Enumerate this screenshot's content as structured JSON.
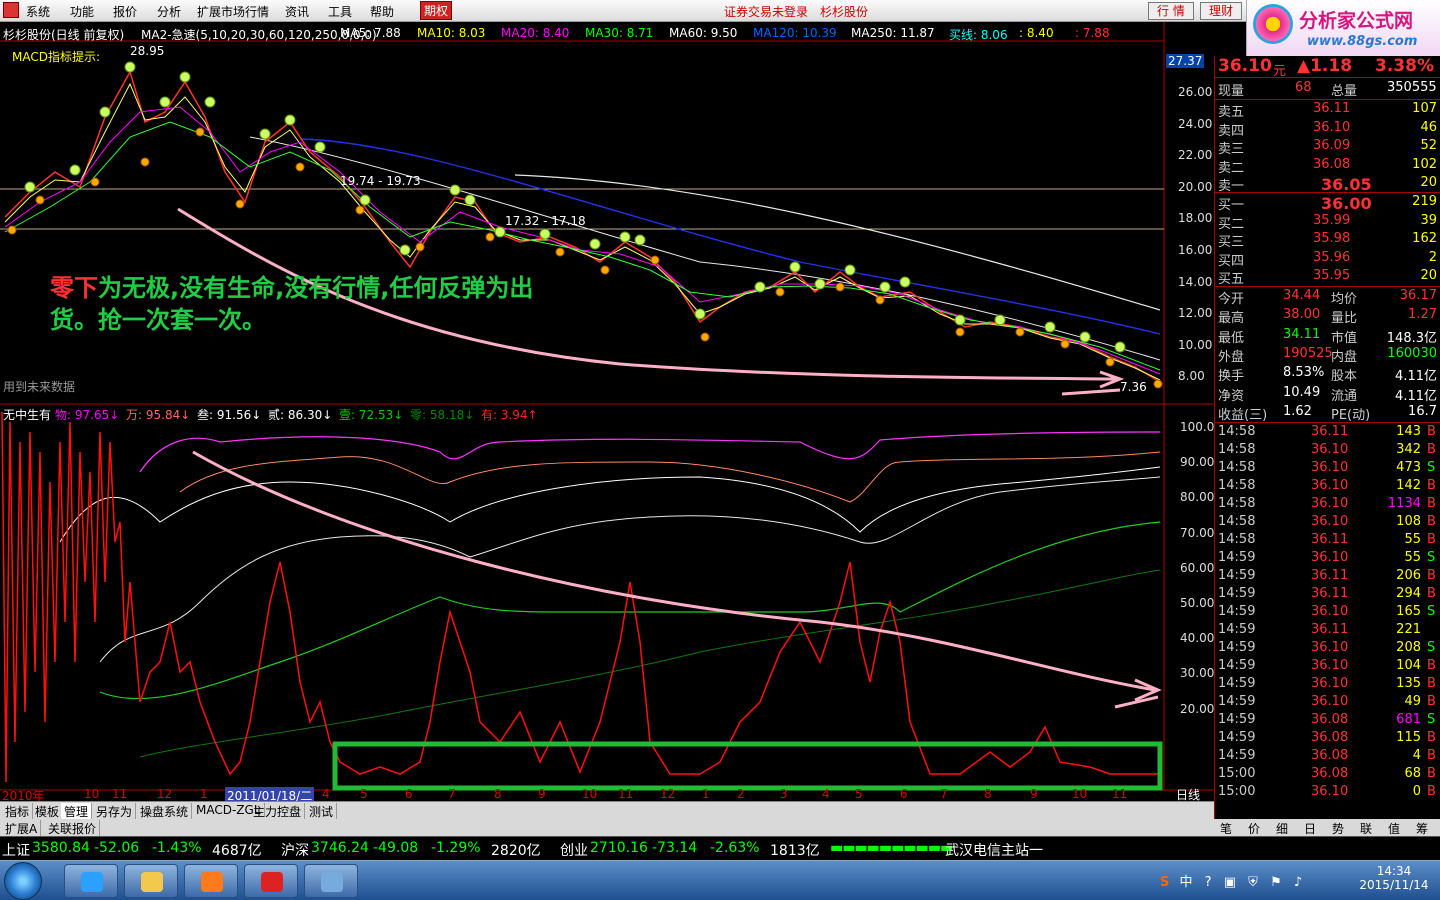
{
  "menubar": {
    "items": [
      "系统",
      "功能",
      "报价",
      "分析",
      "扩展市场行情",
      "资讯",
      "工具",
      "帮助"
    ],
    "active_button": "期权",
    "status": "证券交易未登录",
    "stock_name": "杉杉股份",
    "tabs": [
      "行 情",
      "理财"
    ]
  },
  "logo": {
    "title": "分析家公式网",
    "url_text": "www.88gs.com"
  },
  "main_panel": {
    "title": "杉杉股份(日线 前复权)",
    "formula": "MA2-急速(5,10,20,30,60,120,250,0,0,0)",
    "ma": [
      {
        "label": "MA5: 7.88",
        "color": "#ffffff"
      },
      {
        "label": "MA10: 8.03",
        "color": "#ffff00"
      },
      {
        "label": "MA20: 8.40",
        "color": "#ff00ff"
      },
      {
        "label": "MA30: 8.71",
        "color": "#00ff00"
      },
      {
        "label": "MA60: 9.50",
        "color": "#ffffff"
      },
      {
        "label": "MA120: 10.39",
        "color": "#0066ff"
      },
      {
        "label": "MA250: 11.87",
        "color": "#ffffff"
      },
      {
        "label": "买线: 8.06",
        "color": "#00ffff"
      },
      {
        "label": ": 8.40",
        "color": "#ffff00"
      },
      {
        "label": ": 7.88",
        "color": "#ff3333"
      }
    ],
    "macd_hint": "MACD指标提示:",
    "price_labels": [
      "28.95",
      "19.74 - 19.73",
      "17.32 - 17.18",
      "7.36"
    ],
    "current_price_tag": "27.37",
    "y_ticks": [
      "26.00",
      "24.00",
      "22.00",
      "20.00",
      "18.00",
      "16.00",
      "14.00",
      "12.00",
      "10.00",
      "8.00"
    ],
    "annotation_red": "零下",
    "annotation_green": "为无极,没有生命,没有行情,任何反弹为出",
    "annotation_red2": "货。抢一次套一次。",
    "footnote": "用到未来数据"
  },
  "sub_panel": {
    "title": "无中生有",
    "lines": [
      {
        "label": "物: 97.65",
        "color": "#ff00ff",
        "arrow": "↓"
      },
      {
        "label": "万: 95.84",
        "color": "#ff6666",
        "arrow": "↓"
      },
      {
        "label": "叁: 91.56",
        "color": "#ffffff",
        "arrow": "↓"
      },
      {
        "label": "贰: 86.30",
        "color": "#ffffff",
        "arrow": "↓"
      },
      {
        "label": "壹: 72.53",
        "color": "#00cc00",
        "arrow": "↓"
      },
      {
        "label": "零: 58.18",
        "color": "#008800",
        "arrow": "↓"
      },
      {
        "label": "有: 3.94",
        "color": "#ff2222",
        "arrow": "↑"
      }
    ],
    "y_ticks": [
      "100.0",
      "90.00",
      "80.00",
      "70.00",
      "60.00",
      "50.00",
      "40.00",
      "30.00",
      "20.00"
    ]
  },
  "x_axis": {
    "labels": [
      "2010年",
      "10",
      "11",
      "12",
      "1",
      "2011/01/18/二",
      "4",
      "5",
      "6",
      "7",
      "8",
      "9",
      "10",
      "11",
      "12",
      "1",
      "2",
      "3",
      "4",
      "5",
      "6",
      "7",
      "8",
      "9",
      "10",
      "11"
    ],
    "period": "日线"
  },
  "bottom_tabs": [
    "指标",
    "模板",
    "管理",
    "另存为",
    "操盘系统",
    "MACD-ZGL",
    "主力控盘",
    "测试"
  ],
  "bottom_tabs2": [
    "扩展A",
    "关联报价"
  ],
  "quote": {
    "price": "36.10",
    "unit": "元",
    "change": "▲1.18",
    "change_pct": "3.38%",
    "volume_now_label": "现量",
    "volume_now": "68",
    "volume_total_label": "总量",
    "volume_total": "350555",
    "asks": [
      {
        "label": "卖五",
        "price": "36.11",
        "vol": "107"
      },
      {
        "label": "卖四",
        "price": "36.10",
        "vol": "46"
      },
      {
        "label": "卖三",
        "price": "36.09",
        "vol": "52"
      },
      {
        "label": "卖二",
        "price": "36.08",
        "vol": "102"
      },
      {
        "label": "卖一",
        "price": "36.05",
        "vol": "20"
      }
    ],
    "bids": [
      {
        "label": "买一",
        "price": "36.00",
        "vol": "219"
      },
      {
        "label": "买二",
        "price": "35.99",
        "vol": "39"
      },
      {
        "label": "买三",
        "price": "35.98",
        "vol": "162"
      },
      {
        "label": "买四",
        "price": "35.96",
        "vol": "2"
      },
      {
        "label": "买五",
        "price": "35.95",
        "vol": "20"
      }
    ],
    "stats": [
      {
        "l1": "今开",
        "v1": "34.44",
        "c1": "#ff3333",
        "l2": "均价",
        "v2": "36.17",
        "c2": "#ff3333"
      },
      {
        "l1": "最高",
        "v1": "38.00",
        "c1": "#ff3333",
        "l2": "量比",
        "v2": "1.27",
        "c2": "#ff3333"
      },
      {
        "l1": "最低",
        "v1": "34.11",
        "c1": "#00ff00",
        "l2": "市值",
        "v2": "148.3亿",
        "c2": "#ffffff"
      },
      {
        "l1": "外盘",
        "v1": "190525",
        "c1": "#ff3333",
        "l2": "内盘",
        "v2": "160030",
        "c2": "#00ff00"
      },
      {
        "l1": "换手",
        "v1": "8.53%",
        "c1": "#ffffff",
        "l2": "股本",
        "v2": "4.11亿",
        "c2": "#ffffff"
      },
      {
        "l1": "净资",
        "v1": "10.49",
        "c1": "#ffffff",
        "l2": "流通",
        "v2": "4.11亿",
        "c2": "#ffffff"
      },
      {
        "l1": "收益(三)",
        "v1": "1.62",
        "c1": "#ffffff",
        "l2": "PE(动)",
        "v2": "16.7",
        "c2": "#ffffff"
      }
    ],
    "ticks": [
      {
        "t": "14:58",
        "p": "36.11",
        "v": "143",
        "s": "B"
      },
      {
        "t": "14:58",
        "p": "36.10",
        "v": "342",
        "s": "B"
      },
      {
        "t": "14:58",
        "p": "36.10",
        "v": "473",
        "s": "S"
      },
      {
        "t": "14:58",
        "p": "36.10",
        "v": "142",
        "s": "B"
      },
      {
        "t": "14:58",
        "p": "36.10",
        "v": "1134",
        "s": "B"
      },
      {
        "t": "14:58",
        "p": "36.10",
        "v": "108",
        "s": "B"
      },
      {
        "t": "14:58",
        "p": "36.11",
        "v": "55",
        "s": "B"
      },
      {
        "t": "14:59",
        "p": "36.10",
        "v": "55",
        "s": "S"
      },
      {
        "t": "14:59",
        "p": "36.11",
        "v": "206",
        "s": "B"
      },
      {
        "t": "14:59",
        "p": "36.11",
        "v": "294",
        "s": "B"
      },
      {
        "t": "14:59",
        "p": "36.10",
        "v": "165",
        "s": "S"
      },
      {
        "t": "14:59",
        "p": "36.11",
        "v": "221",
        "s": ""
      },
      {
        "t": "14:59",
        "p": "36.10",
        "v": "208",
        "s": "S"
      },
      {
        "t": "14:59",
        "p": "36.10",
        "v": "104",
        "s": "B"
      },
      {
        "t": "14:59",
        "p": "36.10",
        "v": "135",
        "s": "B"
      },
      {
        "t": "14:59",
        "p": "36.10",
        "v": "49",
        "s": "B"
      },
      {
        "t": "14:59",
        "p": "36.08",
        "v": "681",
        "s": "S"
      },
      {
        "t": "14:59",
        "p": "36.08",
        "v": "115",
        "s": "B"
      },
      {
        "t": "14:59",
        "p": "36.08",
        "v": "4",
        "s": "B"
      },
      {
        "t": "15:00",
        "p": "36.08",
        "v": "68",
        "s": "B"
      },
      {
        "t": "15:00",
        "p": "36.10",
        "v": "0",
        "s": "B"
      }
    ],
    "tabs": [
      "笔",
      "价",
      "细",
      "日",
      "势",
      "联",
      "值",
      "筹"
    ]
  },
  "ticker": {
    "items": [
      {
        "name": "上证",
        "val": "3580.84",
        "chg": "-52.06",
        "pct": "-1.43%",
        "amt": "4687亿"
      },
      {
        "name": "沪深",
        "val": "3746.24",
        "chg": "-49.08",
        "pct": "-1.29%",
        "amt": "2820亿"
      },
      {
        "name": "创业",
        "val": "2710.16",
        "chg": "-73.14",
        "pct": "-2.63%",
        "amt": "1813亿"
      }
    ],
    "server": "武汉电信主站一"
  },
  "taskbar": {
    "time": "14:34",
    "date": "2015/11/14",
    "ime": "中"
  }
}
